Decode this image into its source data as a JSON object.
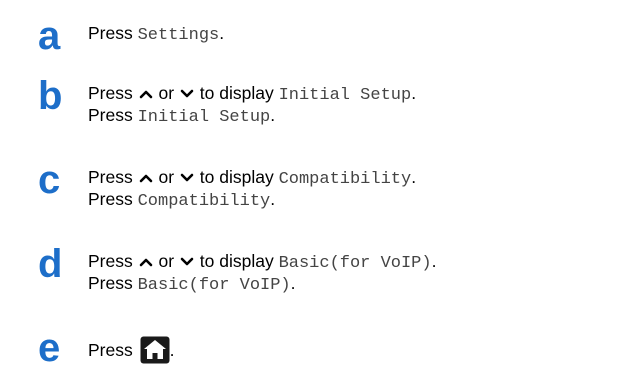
{
  "steps": [
    {
      "letter": "a",
      "lines": [
        {
          "prefix": "Press ",
          "mono": "Settings",
          "suffix": "."
        }
      ]
    },
    {
      "letter": "b",
      "lines": [
        {
          "prefix": "Press ",
          "up_icon": "up-arrow-icon",
          "or": " or ",
          "down_icon": "down-arrow-icon",
          "middle": " to display ",
          "mono": "Initial Setup",
          "suffix": "."
        },
        {
          "prefix": "Press ",
          "mono": "Initial Setup",
          "suffix": "."
        }
      ]
    },
    {
      "letter": "c",
      "lines": [
        {
          "prefix": "Press ",
          "up_icon": "up-arrow-icon",
          "or": " or ",
          "down_icon": "down-arrow-icon",
          "middle": " to display ",
          "mono": "Compatibility",
          "suffix": "."
        },
        {
          "prefix": "Press ",
          "mono": "Compatibility",
          "suffix": "."
        }
      ]
    },
    {
      "letter": "d",
      "lines": [
        {
          "prefix": "Press ",
          "up_icon": "up-arrow-icon",
          "or": " or ",
          "down_icon": "down-arrow-icon",
          "middle": " to display ",
          "mono": "Basic(for VoIP)",
          "suffix": "."
        },
        {
          "prefix": "Press ",
          "mono": "Basic(for VoIP)",
          "suffix": "."
        }
      ]
    },
    {
      "letter": "e",
      "lines": [
        {
          "prefix": "Press ",
          "icon": "home-icon",
          "suffix": "."
        }
      ]
    }
  ],
  "colors": {
    "step_letter": "#1d6ec9",
    "mono_text": "#444444"
  }
}
